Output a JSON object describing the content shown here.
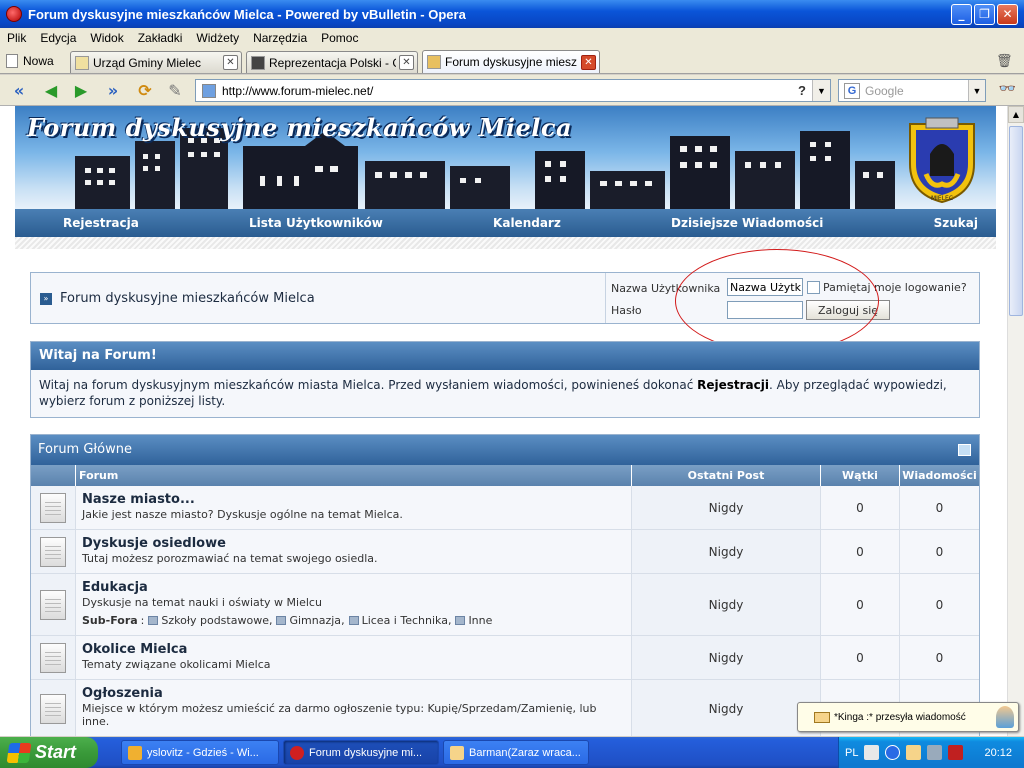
{
  "window": {
    "title": "Forum dyskusyjne mieszkańców Mielca - Powered by vBulletin - Opera"
  },
  "menu": [
    "Plik",
    "Edycja",
    "Widok",
    "Zakładki",
    "Widżety",
    "Narzędzia",
    "Pomoc"
  ],
  "tabs": {
    "new_tab_label": "Nowa",
    "items": [
      {
        "label": "Urząd Gminy Mielec",
        "active": false
      },
      {
        "label": "Reprezentacja Polski - G...",
        "active": false
      },
      {
        "label": "Forum dyskusyjne miesz...",
        "active": true
      }
    ]
  },
  "address": {
    "url": "http://www.forum-mielec.net/",
    "help": "?"
  },
  "search": {
    "placeholder": "Google",
    "engine_glyph": "G"
  },
  "site": {
    "title": "Forum dyskusyjne mieszkańców Mielca",
    "crest_caption": "MIELEC",
    "nav": [
      "Rejestracja",
      "Lista Użytkowników",
      "Kalendarz",
      "Dzisiejsze Wiadomości",
      "Szukaj"
    ]
  },
  "login": {
    "breadcrumb": "Forum dyskusyjne mieszkańców Mielca",
    "username_label": "Nazwa Użytkownika",
    "username_value": "Nazwa Użytk",
    "password_label": "Hasło",
    "remember_label": "Pamiętaj moje logowanie?",
    "submit_label": "Zaloguj się"
  },
  "welcome": {
    "heading": "Witaj na Forum!",
    "text_before": "Witaj na forum dyskusyjnym mieszkańców miasta Mielca. Przed wysłaniem wiadomości, powinieneś dokonać ",
    "text_link": "Rejestracji",
    "text_after": ". Aby przeglądać wypowiedzi, wybierz forum z poniższej listy."
  },
  "forum": {
    "category": "Forum Główne",
    "columns": {
      "forum": "Forum",
      "last_post": "Ostatni Post",
      "threads": "Wątki",
      "posts": "Wiadomości"
    },
    "subforums_label": "Sub-Fora",
    "rows": [
      {
        "title": "Nasze miasto...",
        "desc": "Jakie jest nasze miasto? Dyskusje ogólne na temat Mielca.",
        "last": "Nigdy",
        "threads": "0",
        "posts": "0"
      },
      {
        "title": "Dyskusje osiedlowe",
        "desc": "Tutaj możesz porozmawiać na temat swojego osiedla.",
        "last": "Nigdy",
        "threads": "0",
        "posts": "0"
      },
      {
        "title": "Edukacja",
        "desc": "Dyskusje na temat nauki i oświaty w Mielcu",
        "last": "Nigdy",
        "threads": "0",
        "posts": "0",
        "subforums": [
          "Szkoły podstawowe",
          "Gimnazja",
          "Licea i Technika",
          "Inne"
        ]
      },
      {
        "title": "Okolice Mielca",
        "desc": "Tematy związane okolicami Mielca",
        "last": "Nigdy",
        "threads": "0",
        "posts": "0"
      },
      {
        "title": "Ogłoszenia",
        "desc": "Miejsce w którym możesz umieścić za darmo ogłoszenie typu: Kupię/Sprzedam/Zamienię, lub inne.",
        "last": "Nigdy",
        "threads": "",
        "posts": ""
      }
    ]
  },
  "notification": {
    "text": "*Kinga :* przesyła wiadomość"
  },
  "taskbar": {
    "start_label": "Start",
    "tasks": [
      {
        "label": "yslovitz - Gdzieś - Wi...",
        "active": false
      },
      {
        "label": "Forum dyskusyjne mi...",
        "active": true
      },
      {
        "label": "Barman(Zaraz wraca...",
        "active": false
      }
    ],
    "language": "PL",
    "clock": "20:12"
  },
  "colors": {
    "titlebar": "#0a55d8",
    "nav_strip": "#2a5c90",
    "section_header": "#30629a",
    "annotation_circle": "#d21a1a"
  }
}
